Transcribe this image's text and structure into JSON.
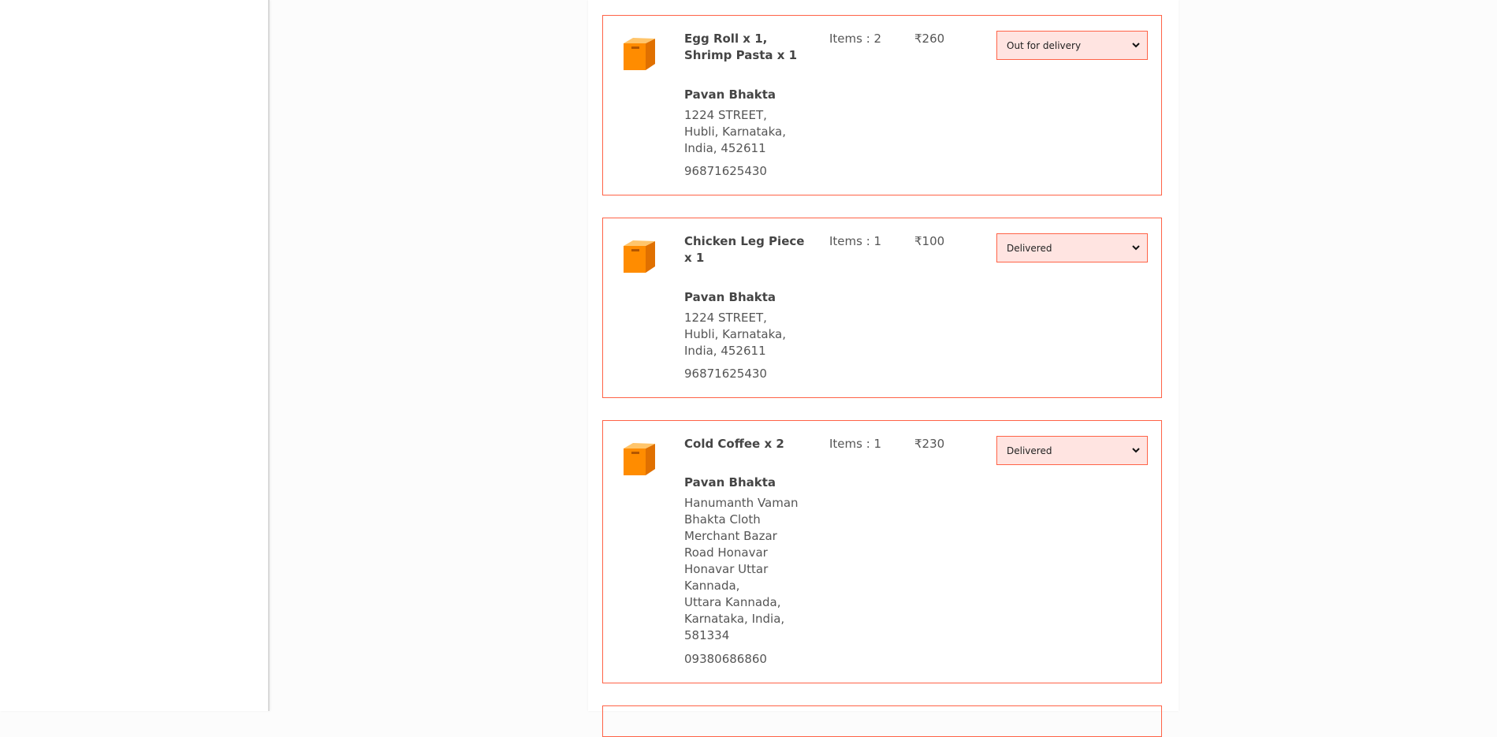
{
  "colors": {
    "accent": "#ff6347",
    "status_bg": "#ffe4e1",
    "icon": "#ff8c00"
  },
  "icons": {
    "order": "box-icon",
    "dropdown": "chevron-down-icon"
  },
  "orders": [
    {
      "items": "Egg Roll x 1, Shrimp Pasta x 1",
      "count": "Items : 2",
      "amount": "₹260",
      "status": "Out for delivery",
      "customer": "Pavan Bhakta",
      "address": [
        "1224 STREET,",
        "Hubli, Karnataka,",
        "India, 452611"
      ],
      "phone": "96871625430"
    },
    {
      "items": "Chicken Leg Piece x 1",
      "count": "Items : 1",
      "amount": "₹100",
      "status": "Delivered",
      "customer": "Pavan Bhakta",
      "address": [
        "1224 STREET,",
        "Hubli, Karnataka,",
        "India, 452611"
      ],
      "phone": "96871625430"
    },
    {
      "items": "Cold Coffee x 2",
      "count": "Items : 1",
      "amount": "₹230",
      "status": "Delivered",
      "customer": "Pavan Bhakta",
      "address": [
        "Hanumanth Vaman Bhakta Cloth Merchant Bazar Road Honavar Honavar Uttar Kannada,",
        "Uttara Kannada, Karnataka, India,",
        "581334"
      ],
      "phone": "09380686860"
    }
  ]
}
